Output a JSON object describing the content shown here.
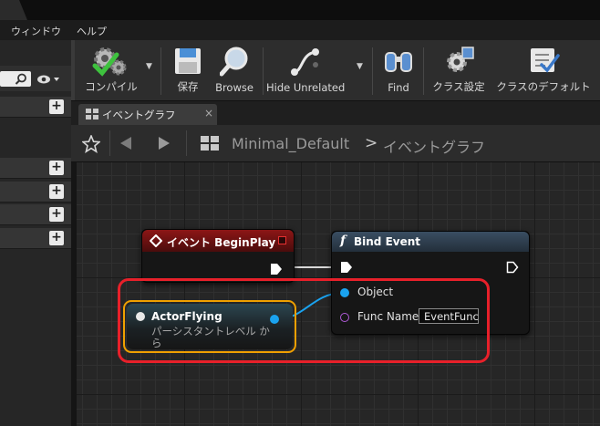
{
  "menu": [
    "ウィンドウ",
    "ヘルプ"
  ],
  "toolbar": {
    "compile": "コンパイル",
    "save": "保存",
    "browse": "Browse",
    "hide_unrelated": "Hide Unrelated",
    "find": "Find",
    "class_settings": "クラス設定",
    "class_defaults": "クラスのデフォルト"
  },
  "graph_tab": {
    "label": "イベントグラフ",
    "close": "×"
  },
  "breadcrumb": {
    "blueprint": "Minimal_Default",
    "separator": ">",
    "graph": "イベントグラフ"
  },
  "nodes": {
    "begin_play": {
      "title": "イベント BeginPlay",
      "color": "#7a1212"
    },
    "bind_event": {
      "title": "Bind Event",
      "func_glyph": "f",
      "object_pin": "Object",
      "func_name_pin": "Func Name",
      "func_name_value": "EventFunc",
      "color": "#2e3e4e"
    },
    "actor_flying": {
      "title": "ActorFlying",
      "subtitle_1": "パーシスタントレベル か",
      "subtitle_2": "ら"
    }
  },
  "colors": {
    "highlight": "#e8202a",
    "selected_outline": "#f0a000",
    "object_pin": "#1aa3f0",
    "delegate_pin": "#b05ad8"
  }
}
